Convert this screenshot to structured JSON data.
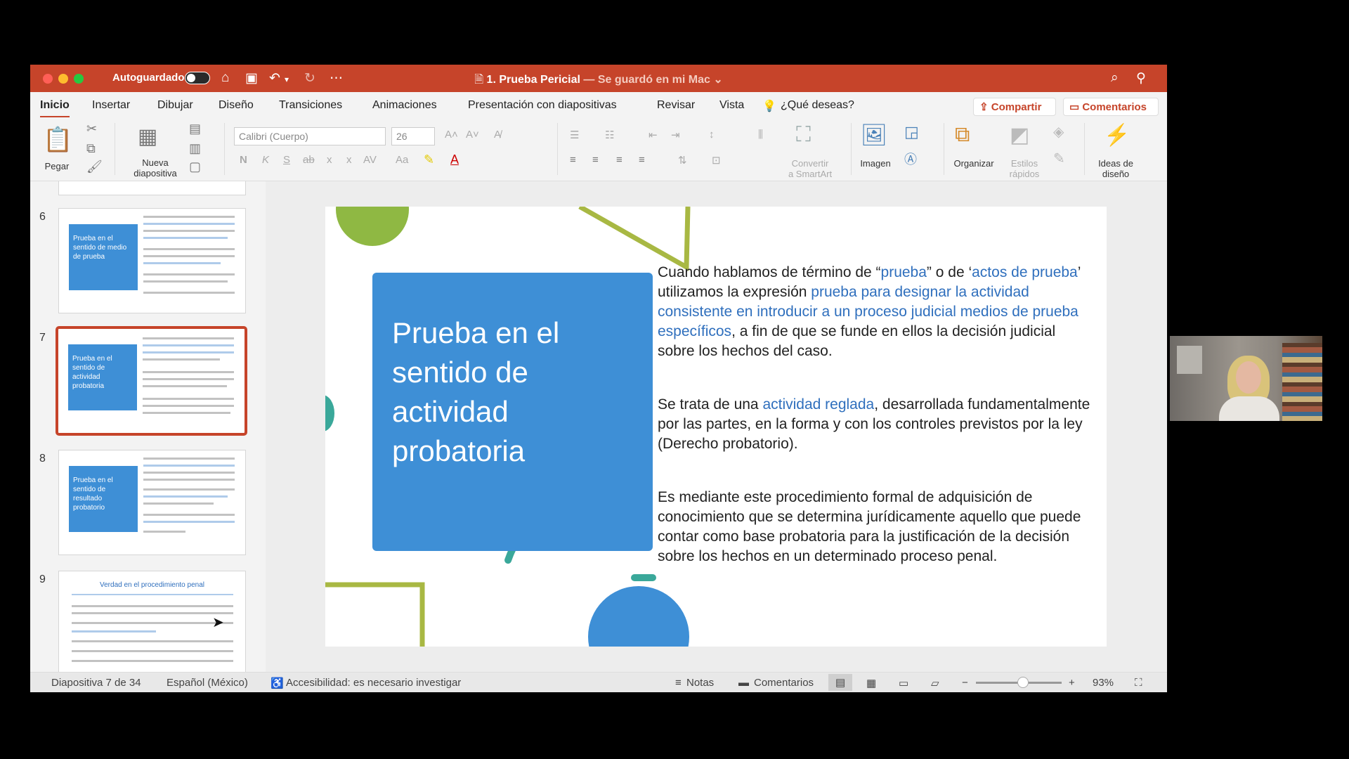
{
  "window": {
    "autosave_label": "Autoguardado",
    "doc_title": "1. Prueba Pericial",
    "doc_status": " — Se guardó en mi Mac",
    "status_chevron": "⌄"
  },
  "tabs": [
    "Inicio",
    "Insertar",
    "Dibujar",
    "Diseño",
    "Transiciones",
    "Animaciones",
    "Presentación con diapositivas",
    "Revisar",
    "Vista"
  ],
  "tell_me": "¿Qué deseas?",
  "share_label": "Compartir",
  "comments_label": "Comentarios",
  "ribbon": {
    "paste": "Pegar",
    "new_slide_1": "Nueva",
    "new_slide_2": "diapositiva",
    "font": "Calibri (Cuerpo)",
    "size": "26",
    "convert_1": "Convertir",
    "convert_2": "a SmartArt",
    "image": "Imagen",
    "arrange": "Organizar",
    "styles_1": "Estilos",
    "styles_2": "rápidos",
    "design_1": "Ideas de",
    "design_2": "diseño",
    "font_buttons": [
      "N",
      "K",
      "S",
      "ab",
      "x",
      "x",
      "AV",
      "Aa"
    ]
  },
  "thumbnails": [
    {
      "num": "6",
      "title": "Prueba en el sentido de medio de prueba"
    },
    {
      "num": "7",
      "title": "Prueba en el sentido de actividad probatoria"
    },
    {
      "num": "8",
      "title": "Prueba en el sentido de resultado probatorio"
    },
    {
      "num": "9",
      "title": "Verdad en el procedimiento penal"
    }
  ],
  "slide": {
    "title": "Prueba en el sentido de actividad probatoria",
    "p1": [
      {
        "t": "Cuando hablamos de término de “",
        "c": 0
      },
      {
        "t": "prueba",
        "c": 1
      },
      {
        "t": "” o de ‘",
        "c": 0
      },
      {
        "t": "actos de prueba",
        "c": 1
      },
      {
        "t": "’ utilizamos la expresión ",
        "c": 0
      },
      {
        "t": "prueba para designar la actividad consistente en introducir a un proceso judicial medios de prueba específicos",
        "c": 1
      },
      {
        "t": ", a fin de que se funde en ellos la decisión judicial sobre los hechos del caso.",
        "c": 0
      }
    ],
    "p2": [
      {
        "t": "Se trata de una ",
        "c": 0
      },
      {
        "t": "actividad reglada",
        "c": 1
      },
      {
        "t": ", desarrollada fundamentalmente por las partes, en la forma y con los controles previstos por la ley (Derecho probatorio).",
        "c": 0
      }
    ],
    "p3": "Es mediante este procedimiento formal de adquisición de conocimiento que se determina jurídicamente aquello que puede contar como base probatoria para la justificación de la decisión sobre los hechos en un determinado proceso penal."
  },
  "status": {
    "slide_of": "Diapositiva 7 de 34",
    "lang": "Español (México)",
    "access": "Accesibilidad: es necesario investigar",
    "notes": "Notas",
    "comments": "Comentarios",
    "zoom": "93%",
    "zoom_level": 0.55
  },
  "colors": {
    "accent": "#c6442a",
    "slide_blue": "#3e8fd6",
    "link_blue": "#2f6fbd",
    "green": "#8fb843",
    "teal": "#3aa89a"
  }
}
